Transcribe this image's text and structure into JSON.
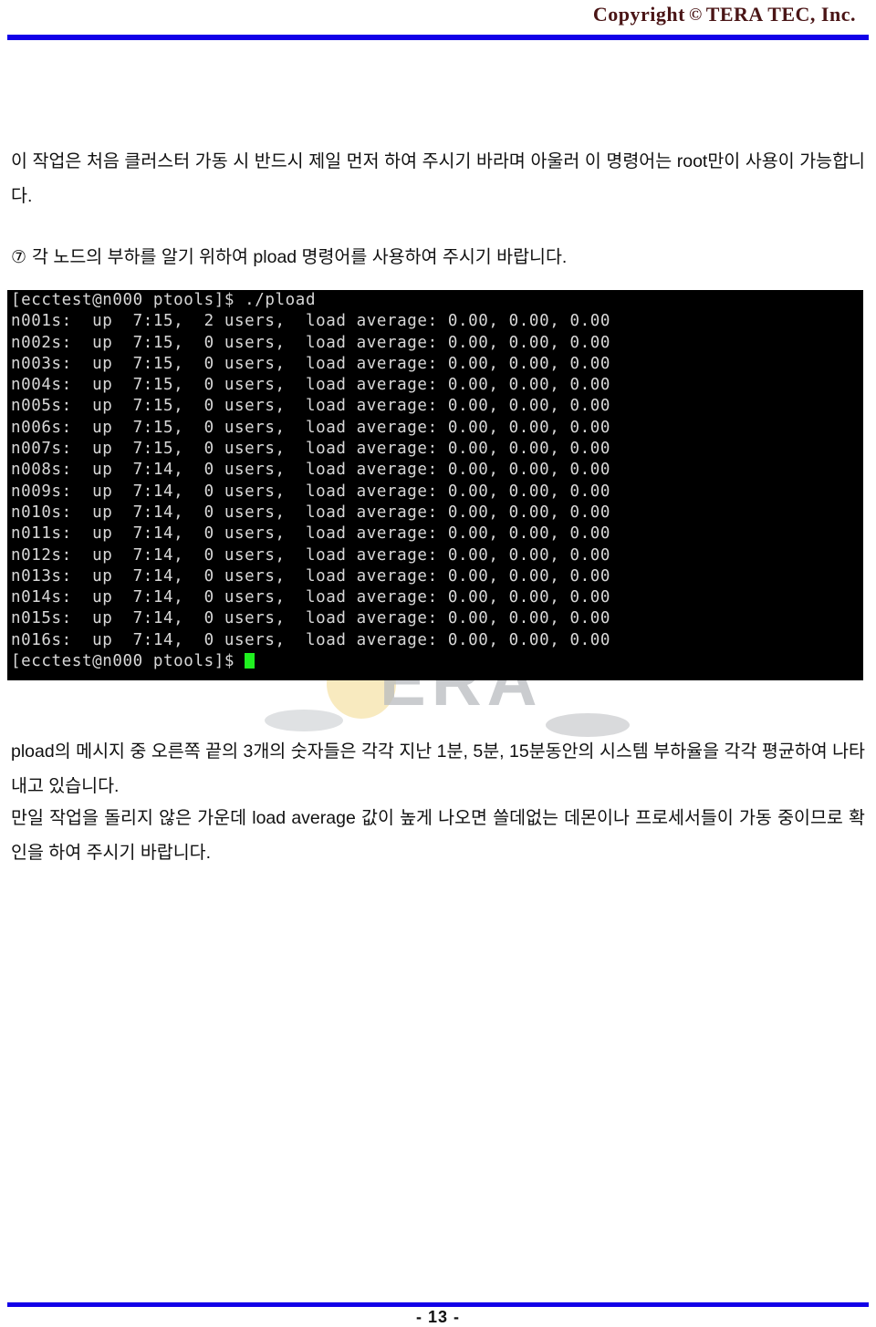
{
  "header": {
    "copyright_prefix": "Copyright",
    "copyright_mark": "©",
    "company": "TERA  TEC,  Inc.",
    "rule_color": "#1200e8"
  },
  "body": {
    "paragraph_intro": "이 작업은 처음 클러스터 가동 시 반드시 제일 먼저 하여 주시기 바라며 아울러 이 명령어는 root만이 사용이 가능합니다.",
    "item_marker": "⑦",
    "paragraph_item7": "각 노드의 부하를 알기 위하여 pload 명령어를 사용하여 주시기 바랍니다.",
    "paragraph_after_1": "pload의 메시지 중 오른쪽 끝의 3개의 숫자들은 각각 지난 1분, 5분, 15분동안의 시스템 부하율을 각각 평균하여 나타내고 있습니다.",
    "paragraph_after_2": "만일 작업을 돌리지 않은 가운데 load average 값이 높게 나오면 쓸데없는 데몬이나 프로세서들이 가동 중이므로 확인을 하여 주시기 바랍니다."
  },
  "terminal": {
    "background": "#000000",
    "foreground": "#d8d8d8",
    "cursor_color": "#20f020",
    "prompt": "[ecctest@n000 ptools]$",
    "command": "./pload",
    "prompt_line": "[ecctest@n000 ptools]$ ./pload",
    "final_prompt_line": "[ecctest@n000 ptools]$ ",
    "nodes": [
      {
        "name": "n001s:",
        "uptime": "7:15,",
        "users": "2 users,",
        "label": "load average:",
        "load1": "0.00,",
        "load5": "0.00,",
        "load15": "0.00",
        "line": "n001s:  up  7:15,  2 users,  load average: 0.00, 0.00, 0.00"
      },
      {
        "name": "n002s:",
        "uptime": "7:15,",
        "users": "0 users,",
        "label": "load average:",
        "load1": "0.00,",
        "load5": "0.00,",
        "load15": "0.00",
        "line": "n002s:  up  7:15,  0 users,  load average: 0.00, 0.00, 0.00"
      },
      {
        "name": "n003s:",
        "uptime": "7:15,",
        "users": "0 users,",
        "label": "load average:",
        "load1": "0.00,",
        "load5": "0.00,",
        "load15": "0.00",
        "line": "n003s:  up  7:15,  0 users,  load average: 0.00, 0.00, 0.00"
      },
      {
        "name": "n004s:",
        "uptime": "7:15,",
        "users": "0 users,",
        "label": "load average:",
        "load1": "0.00,",
        "load5": "0.00,",
        "load15": "0.00",
        "line": "n004s:  up  7:15,  0 users,  load average: 0.00, 0.00, 0.00"
      },
      {
        "name": "n005s:",
        "uptime": "7:15,",
        "users": "0 users,",
        "label": "load average:",
        "load1": "0.00,",
        "load5": "0.00,",
        "load15": "0.00",
        "line": "n005s:  up  7:15,  0 users,  load average: 0.00, 0.00, 0.00"
      },
      {
        "name": "n006s:",
        "uptime": "7:15,",
        "users": "0 users,",
        "label": "load average:",
        "load1": "0.00,",
        "load5": "0.00,",
        "load15": "0.00",
        "line": "n006s:  up  7:15,  0 users,  load average: 0.00, 0.00, 0.00"
      },
      {
        "name": "n007s:",
        "uptime": "7:15,",
        "users": "0 users,",
        "label": "load average:",
        "load1": "0.00,",
        "load5": "0.00,",
        "load15": "0.00",
        "line": "n007s:  up  7:15,  0 users,  load average: 0.00, 0.00, 0.00"
      },
      {
        "name": "n008s:",
        "uptime": "7:14,",
        "users": "0 users,",
        "label": "load average:",
        "load1": "0.00,",
        "load5": "0.00,",
        "load15": "0.00",
        "line": "n008s:  up  7:14,  0 users,  load average: 0.00, 0.00, 0.00"
      },
      {
        "name": "n009s:",
        "uptime": "7:14,",
        "users": "0 users,",
        "label": "load average:",
        "load1": "0.00,",
        "load5": "0.00,",
        "load15": "0.00",
        "line": "n009s:  up  7:14,  0 users,  load average: 0.00, 0.00, 0.00"
      },
      {
        "name": "n010s:",
        "uptime": "7:14,",
        "users": "0 users,",
        "label": "load average:",
        "load1": "0.00,",
        "load5": "0.00,",
        "load15": "0.00",
        "line": "n010s:  up  7:14,  0 users,  load average: 0.00, 0.00, 0.00"
      },
      {
        "name": "n011s:",
        "uptime": "7:14,",
        "users": "0 users,",
        "label": "load average:",
        "load1": "0.00,",
        "load5": "0.00,",
        "load15": "0.00",
        "line": "n011s:  up  7:14,  0 users,  load average: 0.00, 0.00, 0.00"
      },
      {
        "name": "n012s:",
        "uptime": "7:14,",
        "users": "0 users,",
        "label": "load average:",
        "load1": "0.00,",
        "load5": "0.00,",
        "load15": "0.00",
        "line": "n012s:  up  7:14,  0 users,  load average: 0.00, 0.00, 0.00"
      },
      {
        "name": "n013s:",
        "uptime": "7:14,",
        "users": "0 users,",
        "label": "load average:",
        "load1": "0.00,",
        "load5": "0.00,",
        "load15": "0.00",
        "line": "n013s:  up  7:14,  0 users,  load average: 0.00, 0.00, 0.00"
      },
      {
        "name": "n014s:",
        "uptime": "7:14,",
        "users": "0 users,",
        "label": "load average:",
        "load1": "0.00,",
        "load5": "0.00,",
        "load15": "0.00",
        "line": "n014s:  up  7:14,  0 users,  load average: 0.00, 0.00, 0.00"
      },
      {
        "name": "n015s:",
        "uptime": "7:14,",
        "users": "0 users,",
        "label": "load average:",
        "load1": "0.00,",
        "load5": "0.00,",
        "load15": "0.00",
        "line": "n015s:  up  7:14,  0 users,  load average: 0.00, 0.00, 0.00"
      },
      {
        "name": "n016s:",
        "uptime": "7:14,",
        "users": "0 users,",
        "label": "load average:",
        "load1": "0.00,",
        "load5": "0.00,",
        "load15": "0.00",
        "line": "n016s:  up  7:14,  0 users,  load average: 0.00, 0.00, 0.00"
      }
    ]
  },
  "watermark": {
    "text": "ERA",
    "disc_color": "#f2d98a",
    "text_color": "#b9bcc0"
  },
  "footer": {
    "page_number": "- 13 -",
    "rule_color": "#1200e8"
  }
}
